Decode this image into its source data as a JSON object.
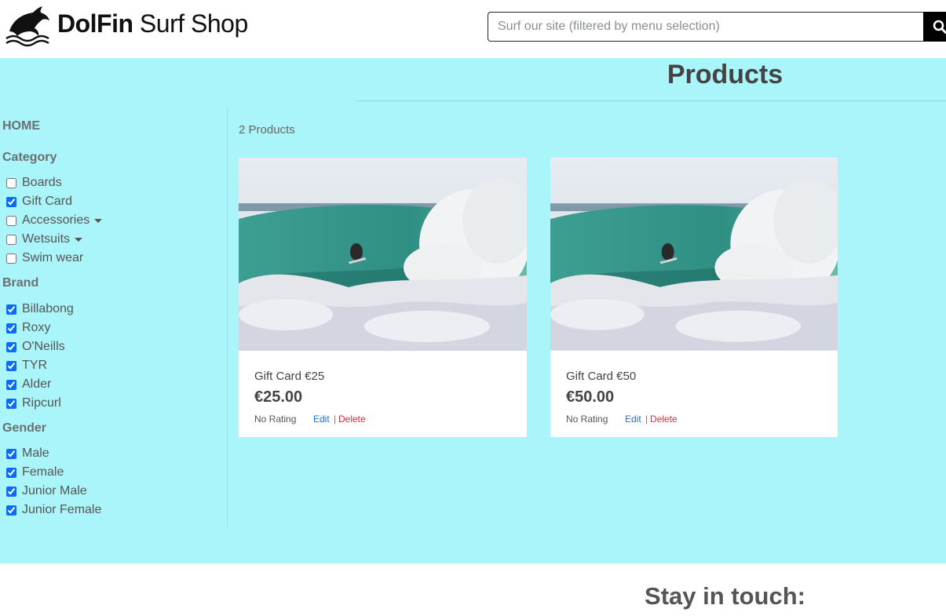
{
  "header": {
    "brand_bold": "DolFin",
    "brand_rest": "Surf Shop",
    "search_placeholder": "Surf our site (filtered by menu selection)",
    "logo_icon": "dolphin-logo-icon",
    "search_icon": "search-icon"
  },
  "main": {
    "title": "Products",
    "product_count": "2 Products",
    "background": "#aaf5fa"
  },
  "sidebar": {
    "home": "HOME",
    "category_heading": "Category",
    "categories": [
      {
        "label": "Boards",
        "checked": false,
        "dropdown": false
      },
      {
        "label": "Gift Card",
        "checked": true,
        "dropdown": false
      },
      {
        "label": "Accessories",
        "checked": false,
        "dropdown": true
      },
      {
        "label": "Wetsuits",
        "checked": false,
        "dropdown": true
      },
      {
        "label": "Swim wear",
        "checked": false,
        "dropdown": false
      }
    ],
    "brand_heading": "Brand",
    "brands": [
      {
        "label": "Billabong",
        "checked": true
      },
      {
        "label": "Roxy",
        "checked": true
      },
      {
        "label": "O'Neills",
        "checked": true
      },
      {
        "label": "TYR",
        "checked": true
      },
      {
        "label": "Alder",
        "checked": true
      },
      {
        "label": "Ripcurl",
        "checked": true
      }
    ],
    "gender_heading": "Gender",
    "genders": [
      {
        "label": "Male",
        "checked": true
      },
      {
        "label": "Female",
        "checked": true
      },
      {
        "label": "Junior Male",
        "checked": true
      },
      {
        "label": "Junior Female",
        "checked": true
      }
    ]
  },
  "products": [
    {
      "name": "Gift Card €25",
      "price": "€25.00",
      "rating": "No Rating",
      "edit": "Edit",
      "sep": "|",
      "delete": "Delete"
    },
    {
      "name": "Gift Card €50",
      "price": "€50.00",
      "rating": "No Rating",
      "edit": "Edit",
      "sep": "|",
      "delete": "Delete"
    }
  ],
  "footer": {
    "title": "Stay in touch:"
  }
}
